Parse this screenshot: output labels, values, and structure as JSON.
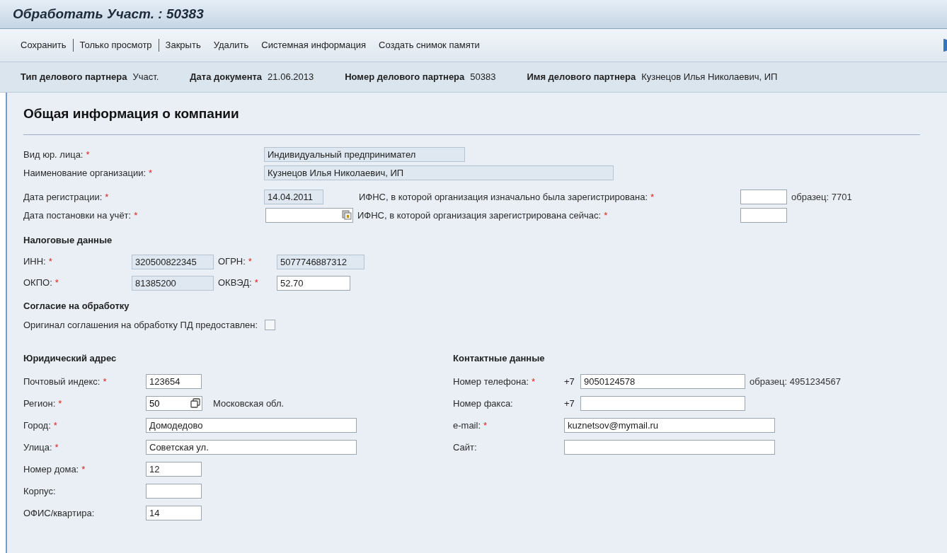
{
  "window": {
    "title": "Обработать Участ. : 50383"
  },
  "toolbar": [
    {
      "kind": "button",
      "label": "Сохранить"
    },
    {
      "kind": "separator"
    },
    {
      "kind": "button",
      "label": "Только просмотр"
    },
    {
      "kind": "separator"
    },
    {
      "kind": "button",
      "label": "Закрыть"
    },
    {
      "kind": "button",
      "label": "Удалить"
    },
    {
      "kind": "button",
      "label": "Системная информация"
    },
    {
      "kind": "button",
      "label": "Создать снимок памяти"
    }
  ],
  "header": [
    {
      "label": "Тип делового партнера",
      "value": "Участ."
    },
    {
      "label": "Дата документа",
      "value": "21.06.2013"
    },
    {
      "label": "Номер делового партнера",
      "value": "50383"
    },
    {
      "label": "Имя делового партнера",
      "value": "Кузнецов Илья Николаевич, ИП"
    }
  ],
  "section_title": "Общая информация о компании",
  "legal_form": {
    "label": "Вид юр. лица:",
    "required_mark": "*",
    "value": "Индивидуальный предпринимател",
    "readonly": true
  },
  "org_name": {
    "label": "Наименование организации:",
    "required_mark": "*",
    "value": "Кузнецов Илья Николаевич, ИП",
    "readonly": true
  },
  "reg_date": {
    "label": "Дата регистрации:",
    "required_mark": "*",
    "value": "14.04.2011",
    "readonly": true
  },
  "ifns_initial": {
    "label": "ИФНС, в которой организация изначально была зарегистрирована:",
    "required_mark": "*",
    "readonly": false,
    "hint": "образец: 7701"
  },
  "tax_date": {
    "label": "Дата постановки на учёт:",
    "required_mark": "*",
    "readonly": false
  },
  "ifns_current": {
    "label": "ИФНС, в которой организация зарегистрирована сейчас:",
    "required_mark": "*",
    "readonly": false
  },
  "tax_title": "Налоговые данные",
  "tax_rows": [
    [
      {
        "label": "ИНН:",
        "required_mark": "*",
        "value": "320500822345",
        "readonly": true
      },
      {
        "label": "ОГРН:",
        "required_mark": "*",
        "value": "5077746887312",
        "readonly": true
      }
    ],
    [
      {
        "label": "ОКПО:",
        "required_mark": "*",
        "value": "81385200",
        "readonly": true
      },
      {
        "label": "ОКВЭД:",
        "required_mark": "*",
        "value": "52.70",
        "readonly": false
      }
    ]
  ],
  "consent_title": "Согласие на обработку",
  "consent": {
    "label": "Оригинал соглашения на обработку ПД предоставлен:",
    "checked": false
  },
  "address_title": "Юридический адрес",
  "address": [
    {
      "kind": "short",
      "label": "Почтовый индекс:",
      "required_mark": "*",
      "value": "123654"
    },
    {
      "kind": "lookup",
      "label": "Регион:",
      "required_mark": "*",
      "value": "50",
      "description": "Московская обл."
    },
    {
      "kind": "long",
      "label": "Город:",
      "required_mark": "*",
      "value": "Домодедово"
    },
    {
      "kind": "long",
      "label": "Улица:",
      "required_mark": "*",
      "value": "Советская ул."
    },
    {
      "kind": "short",
      "label": "Номер дома:",
      "required_mark": "*",
      "value": "12"
    },
    {
      "kind": "short",
      "label": "Корпус:"
    },
    {
      "kind": "short",
      "label": "ОФИС/квартира:",
      "value": "14"
    }
  ],
  "contacts_title": "Контактные данные",
  "contacts": [
    {
      "kind": "phone",
      "label": "Номер телефона:",
      "required_mark": "*",
      "prefix": "+7",
      "value": "9050124578",
      "hint": "образец: 4951234567"
    },
    {
      "kind": "phone",
      "label": "Номер факса:",
      "prefix": "+7"
    },
    {
      "kind": "text",
      "label": "e-mail:",
      "required_mark": "*",
      "value": "kuznetsov@mymail.ru"
    },
    {
      "kind": "text",
      "label": "Сайт:"
    }
  ]
}
